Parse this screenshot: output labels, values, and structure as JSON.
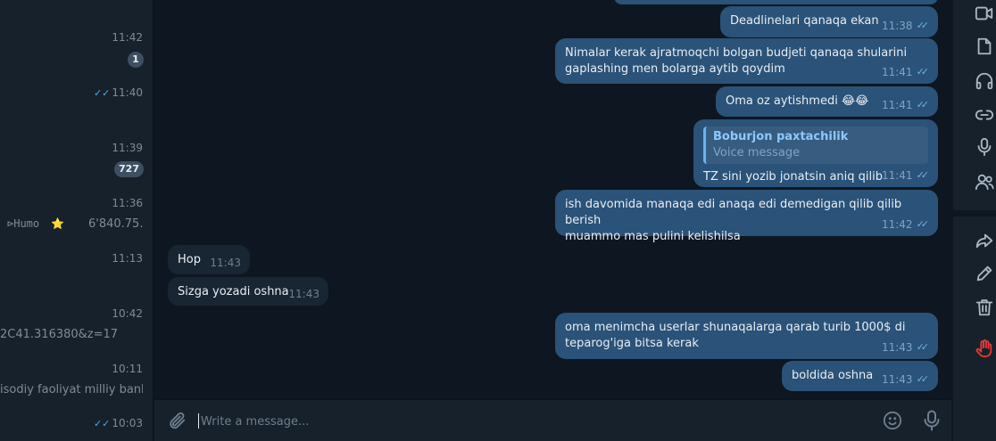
{
  "chat_list": {
    "items": [
      {
        "time": "11:42",
        "badge": "1"
      },
      {
        "time": "11:40",
        "read_check": "✓✓"
      },
      {
        "time": "11:39",
        "badge": "727"
      },
      {
        "time": "11:36",
        "preview_left": "⊳Humo",
        "preview_emoji": "⭐",
        "preview_right": "6'840.75..."
      },
      {
        "time": "11:13"
      },
      {
        "time": "10:42",
        "preview": "2C41.316380&z=17"
      },
      {
        "time": "10:11",
        "preview": "isodiy faoliyat milliy bank..."
      },
      {
        "time": "10:03",
        "read_check": "✓✓"
      }
    ]
  },
  "messages": [
    {
      "dir": "out",
      "text": "Deadlinelari qanaqa ekan",
      "time": "11:38",
      "read": "✓✓"
    },
    {
      "dir": "out",
      "text": "Nimalar kerak ajratmoqchi bolgan budjeti qanaqa shularini\ngaplashing men bolarga aytib qoydim",
      "time": "11:41",
      "read": "✓✓"
    },
    {
      "dir": "out",
      "text": "Oma oz aytishmedi 😂😂",
      "time": "11:41",
      "read": "✓✓"
    },
    {
      "dir": "out",
      "reply_name": "Boburjon paxtachilik",
      "reply_sub": "Voice message",
      "text": "TZ sini yozib jonatsin aniq qilib",
      "time": "11:41",
      "read": "✓✓"
    },
    {
      "dir": "out",
      "text": "ish davomida manaqa edi anaqa edi demedigan qilib qilib berish\nmuammo mas pulini kelishilsa",
      "time": "11:42",
      "read": "✓✓"
    },
    {
      "dir": "in",
      "text": "Hop",
      "time": "11:43"
    },
    {
      "dir": "in",
      "text": "Sizga yozadi oshna",
      "time": "11:43"
    },
    {
      "dir": "out",
      "text": "oma menimcha userlar shunaqalarga qarab turib 1000$ di\nteparog'iga bitsa kerak",
      "time": "11:43",
      "read": "✓✓"
    },
    {
      "dir": "out",
      "text": "boldida oshna",
      "time": "11:43",
      "read": "✓✓"
    }
  ],
  "composer": {
    "placeholder": "Write a message..."
  },
  "rail": {
    "icons": [
      "video-icon",
      "file-icon",
      "headphones-icon",
      "link-icon",
      "microphone-icon",
      "users-icon",
      "forward-icon",
      "edit-icon",
      "delete-icon",
      "hand-icon"
    ]
  },
  "colors": {
    "background": "#0e1621",
    "panel": "#17212b",
    "outgoing_bubble": "#2b5278",
    "incoming_bubble": "#182533",
    "accent": "#6ab3f3",
    "danger": "#e53935"
  }
}
